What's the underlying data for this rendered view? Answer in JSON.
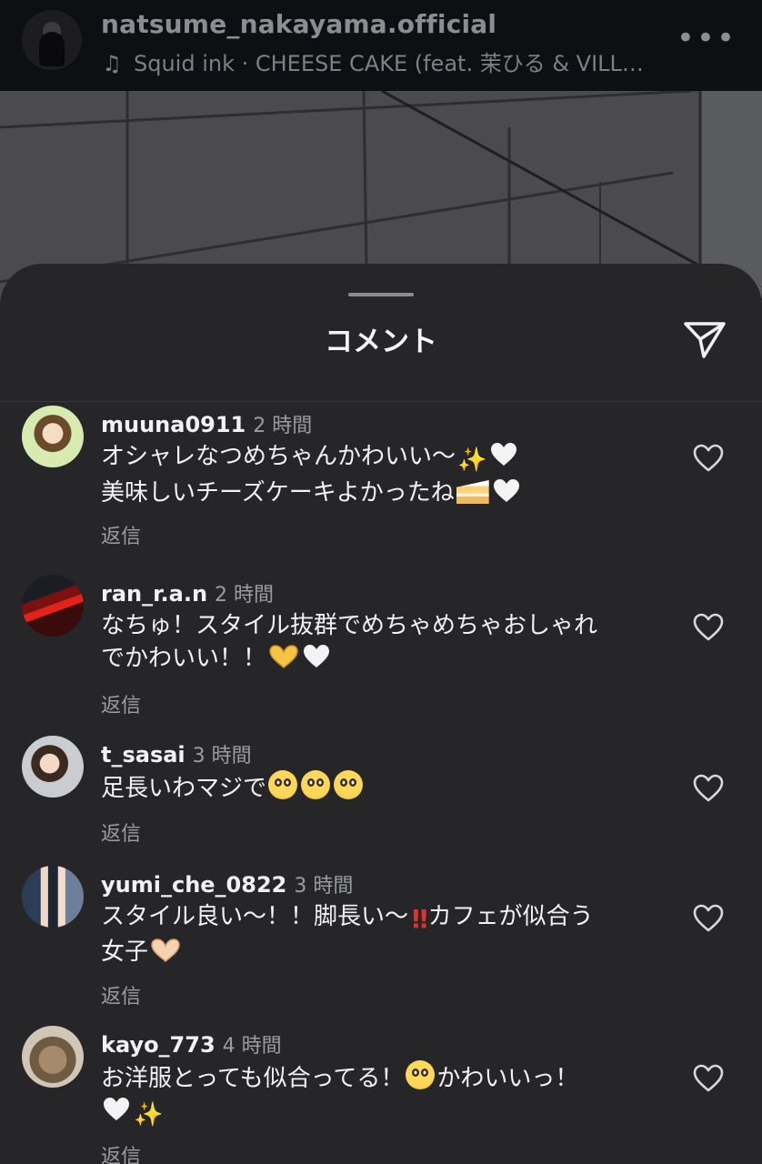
{
  "post": {
    "username": "natsume_nakayama.official",
    "music_icon": "music-note-icon",
    "audio": "Squid ink · CHEESE CAKE (feat. 茉ひる & VILL…",
    "more": "•••"
  },
  "sheet": {
    "title": "コメント",
    "share_icon": "send-icon"
  },
  "comments": [
    {
      "username": "muuna0911",
      "time": "2 時間",
      "lines": [
        "オシャレなつめちゃんかわいい〜",
        "美味しいチーズケーキよかったね"
      ],
      "reply": "返信"
    },
    {
      "username": "ran_r.a.n",
      "time": "2 時間",
      "lines": [
        "なちゅ！スタイル抜群でめちゃめちゃおしゃれ",
        "でかわいい！！"
      ],
      "reply": "返信"
    },
    {
      "username": "t_sasai",
      "time": "3 時間",
      "lines": [
        "足長いわマジで"
      ],
      "reply": "返信"
    },
    {
      "username": "yumi_che_0822",
      "time": "3 時間",
      "lines": [
        "スタイル良い〜！！脚長い〜",
        "カフェが似合う",
        "女子"
      ],
      "reply": "返信"
    },
    {
      "username": "kayo_773",
      "time": "4 時間",
      "lines": [
        "お洋服とっても似合ってる！",
        "かわいいっ！"
      ],
      "reply": "返信"
    }
  ],
  "colors": {
    "sheet_bg": "#262629",
    "header_bg": "#0e0f13",
    "muted_text": "#9a9ca2"
  }
}
